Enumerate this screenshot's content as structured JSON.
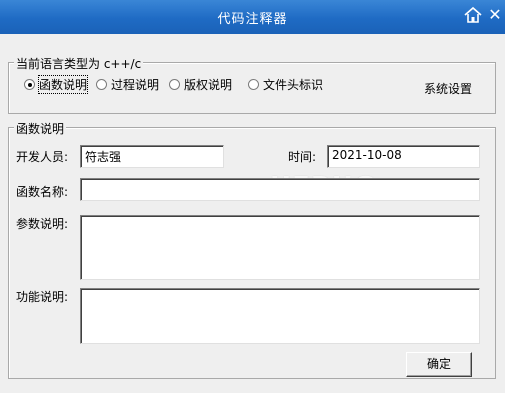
{
  "window": {
    "title": "代码注释器"
  },
  "language_group": {
    "label": "当前语言类型为 c++/c",
    "options": [
      "函数说明",
      "过程说明",
      "版权说明",
      "文件头标识"
    ],
    "selected": "函数说明",
    "settings_label": "系统设置"
  },
  "function_group": {
    "label": "函数说明",
    "developer_label": "开发人员:",
    "developer_value": "符志强",
    "time_label": "时间:",
    "time_value": "2021-10-08",
    "name_label": "函数名称:",
    "name_value": "",
    "params_label": "参数说明:",
    "params_value": "",
    "features_label": "功能说明:",
    "features_value": ""
  },
  "buttons": {
    "ok": "确定"
  },
  "watermark": "UEBUG"
}
